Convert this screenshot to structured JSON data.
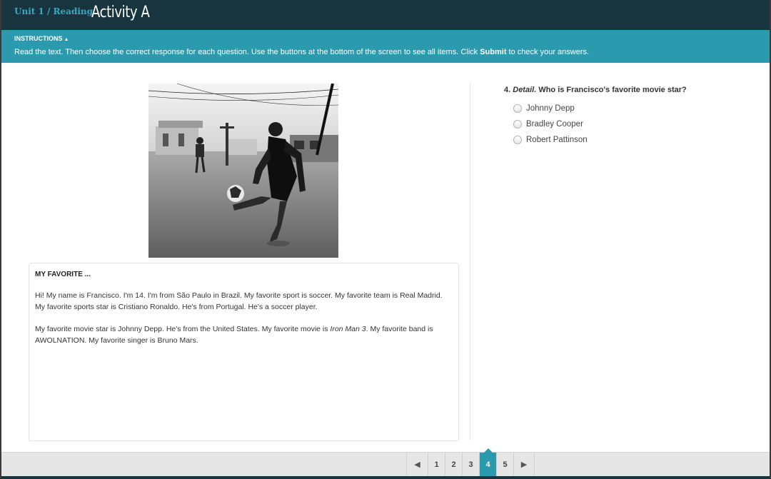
{
  "header": {
    "breadcrumb": "Unit 1 / Reading",
    "title": "Activity A"
  },
  "instructions": {
    "heading": "INSTRUCTIONS",
    "toggle_icon": "triangle-up-icon",
    "text_before": "Read the text. Then choose the correct response for each question. Use the buttons at the bottom of the screen to see all items. Click ",
    "text_bold": "Submit",
    "text_after": " to check your answers."
  },
  "passage": {
    "title": "MY FAVORITE ...",
    "p1": "Hi! My name is Francisco. I'm 14. I'm from São Paulo in Brazil. My favorite sport is soccer. My favorite team is Real Madrid. My favorite sports star is Cristiano Ronaldo. He's from Portugal. He's a soccer player.",
    "p2_before": "My favorite movie star is Johnny Depp. He's from the United States. My favorite movie is ",
    "p2_italic": "Iron Man 3",
    "p2_after": ". My favorite band is AWOLNATION. My favorite singer is Bruno Mars."
  },
  "question": {
    "number": "4.",
    "skill": "Detail.",
    "text": "Who is Francisco's favorite movie star?",
    "options": [
      "Johnny Depp",
      "Bradley Cooper",
      "Robert Pattinson"
    ]
  },
  "pagination": {
    "prev_icon": "triangle-left-icon",
    "next_icon": "triangle-right-icon",
    "pages": [
      "1",
      "2",
      "3",
      "4",
      "5"
    ],
    "current": "4"
  },
  "colors": {
    "header_bg": "#17343f",
    "accent": "#2c9aae",
    "breadcrumb": "#39a9bd"
  }
}
